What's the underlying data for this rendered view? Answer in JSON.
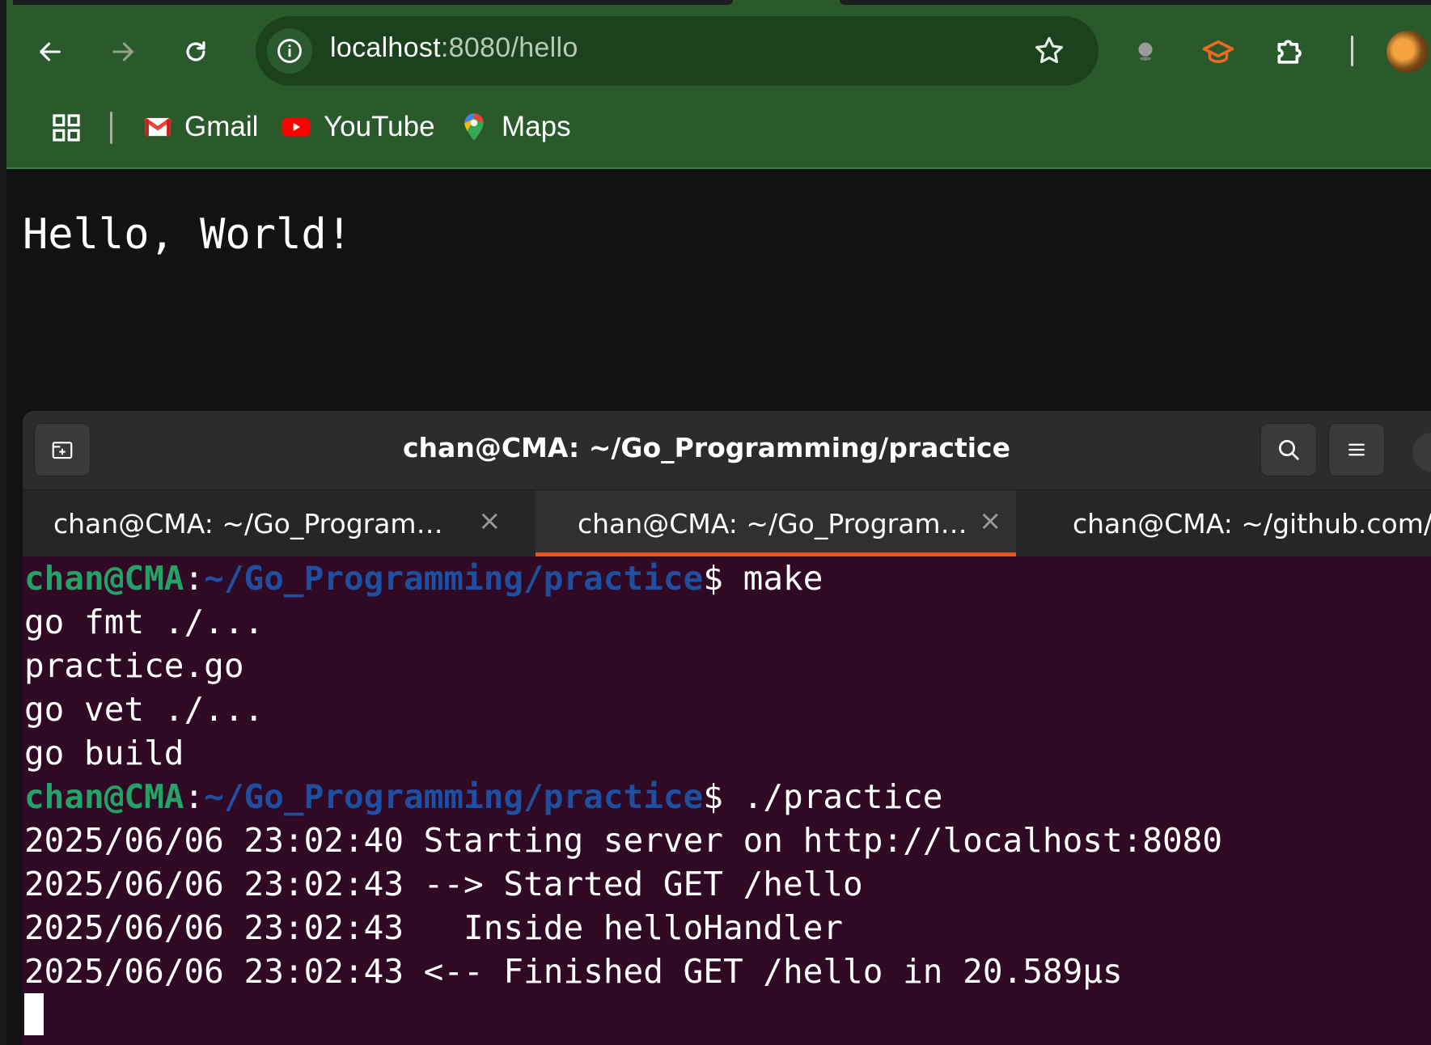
{
  "browser": {
    "url_host": "localhost",
    "url_path": ":8080/hello",
    "bookmarks": [
      "Gmail",
      "YouTube",
      "Maps"
    ]
  },
  "page": {
    "content_text": "Hello, World!"
  },
  "terminal": {
    "window_title": "chan@CMA: ~/Go_Programming/practice",
    "tabs": [
      {
        "label": "chan@CMA: ~/Go_Program…",
        "active": false
      },
      {
        "label": "chan@CMA: ~/Go_Program…",
        "active": true
      },
      {
        "label": "chan@CMA: ~/github.com/…",
        "active": false
      }
    ],
    "close_glyph": "×",
    "prompt_user": "chan@CMA",
    "prompt_sep": ":",
    "prompt_path": "~/Go_Programming/practice",
    "prompt_dollar": "$",
    "command_1": " make",
    "output_1": [
      "go fmt ./...",
      "practice.go",
      "go vet ./...",
      "go build"
    ],
    "command_2": " ./practice",
    "output_2": [
      "2025/06/06 23:02:40 Starting server on http://localhost:8080",
      "2025/06/06 23:02:43 --> Started GET /hello",
      "2025/06/06 23:02:43   Inside helloHandler",
      "2025/06/06 23:02:43 <-- Finished GET /hello in 20.589µs"
    ]
  },
  "colors": {
    "browser_bar": "#2a5a2c",
    "terminal_bg": "#300a24",
    "prompt_user": "#26a269",
    "prompt_path": "#1f4fa0",
    "active_tab_accent": "#e95420"
  },
  "icons": [
    "back-arrow-icon",
    "forward-arrow-icon",
    "reload-icon",
    "site-info-icon",
    "bookmark-star-icon",
    "extension-dot-icon",
    "graduation-cap-icon",
    "puzzle-piece-icon",
    "profile-avatar",
    "apps-grid-icon",
    "gmail-icon",
    "youtube-icon",
    "maps-pin-icon",
    "new-tab-icon",
    "search-icon",
    "hamburger-menu-icon"
  ]
}
